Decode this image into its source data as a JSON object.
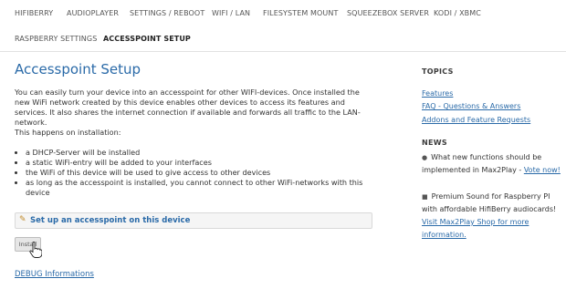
{
  "nav": {
    "row1": [
      "HIFIBERRY",
      "AUDIOPLAYER",
      "SETTINGS / REBOOT",
      "WIFI / LAN",
      "FILESYSTEM MOUNT",
      "SQUEEZEBOX SERVER",
      "KODI / XBMC"
    ],
    "row2": [
      "RASPBERRY SETTINGS",
      "ACCESSPOINT SETUP"
    ],
    "active": "ACCESSPOINT SETUP"
  },
  "main": {
    "title": "Accesspoint Setup",
    "intro": "You can easily turn your device into an accesspoint for other WIFI-devices. Once installed the new WiFi network created by this device enables other devices to access its features and services. It also shares the internet connection if available and forwards all traffic to the LAN-network.",
    "happens": "This happens on installation:",
    "bullets": [
      "a DHCP-Server will be installed",
      "a static WiFi-entry will be added to your interfaces",
      "the WiFi of this device will be used to give access to other devices",
      "as long as the accesspoint is installed, you cannot connect to other WiFi-networks with this device"
    ],
    "setup_label": "Set up an accesspoint on this device",
    "install_label": "Install",
    "debug_label": "DEBUG Informations"
  },
  "sidebar": {
    "topics_heading": "TOPICS",
    "topics": [
      "Features",
      "FAQ - Questions & Answers",
      "Addons and Feature Requests"
    ],
    "news_heading": "NEWS",
    "news1_text": "What new functions should be implemented in Max2Play - ",
    "news1_link": "Vote now!",
    "news2_text": "Premium Sound for Raspberry PI with affordable HifiBerry audiocards! ",
    "news2_link": "Visit Max2Play Shop for more information."
  }
}
